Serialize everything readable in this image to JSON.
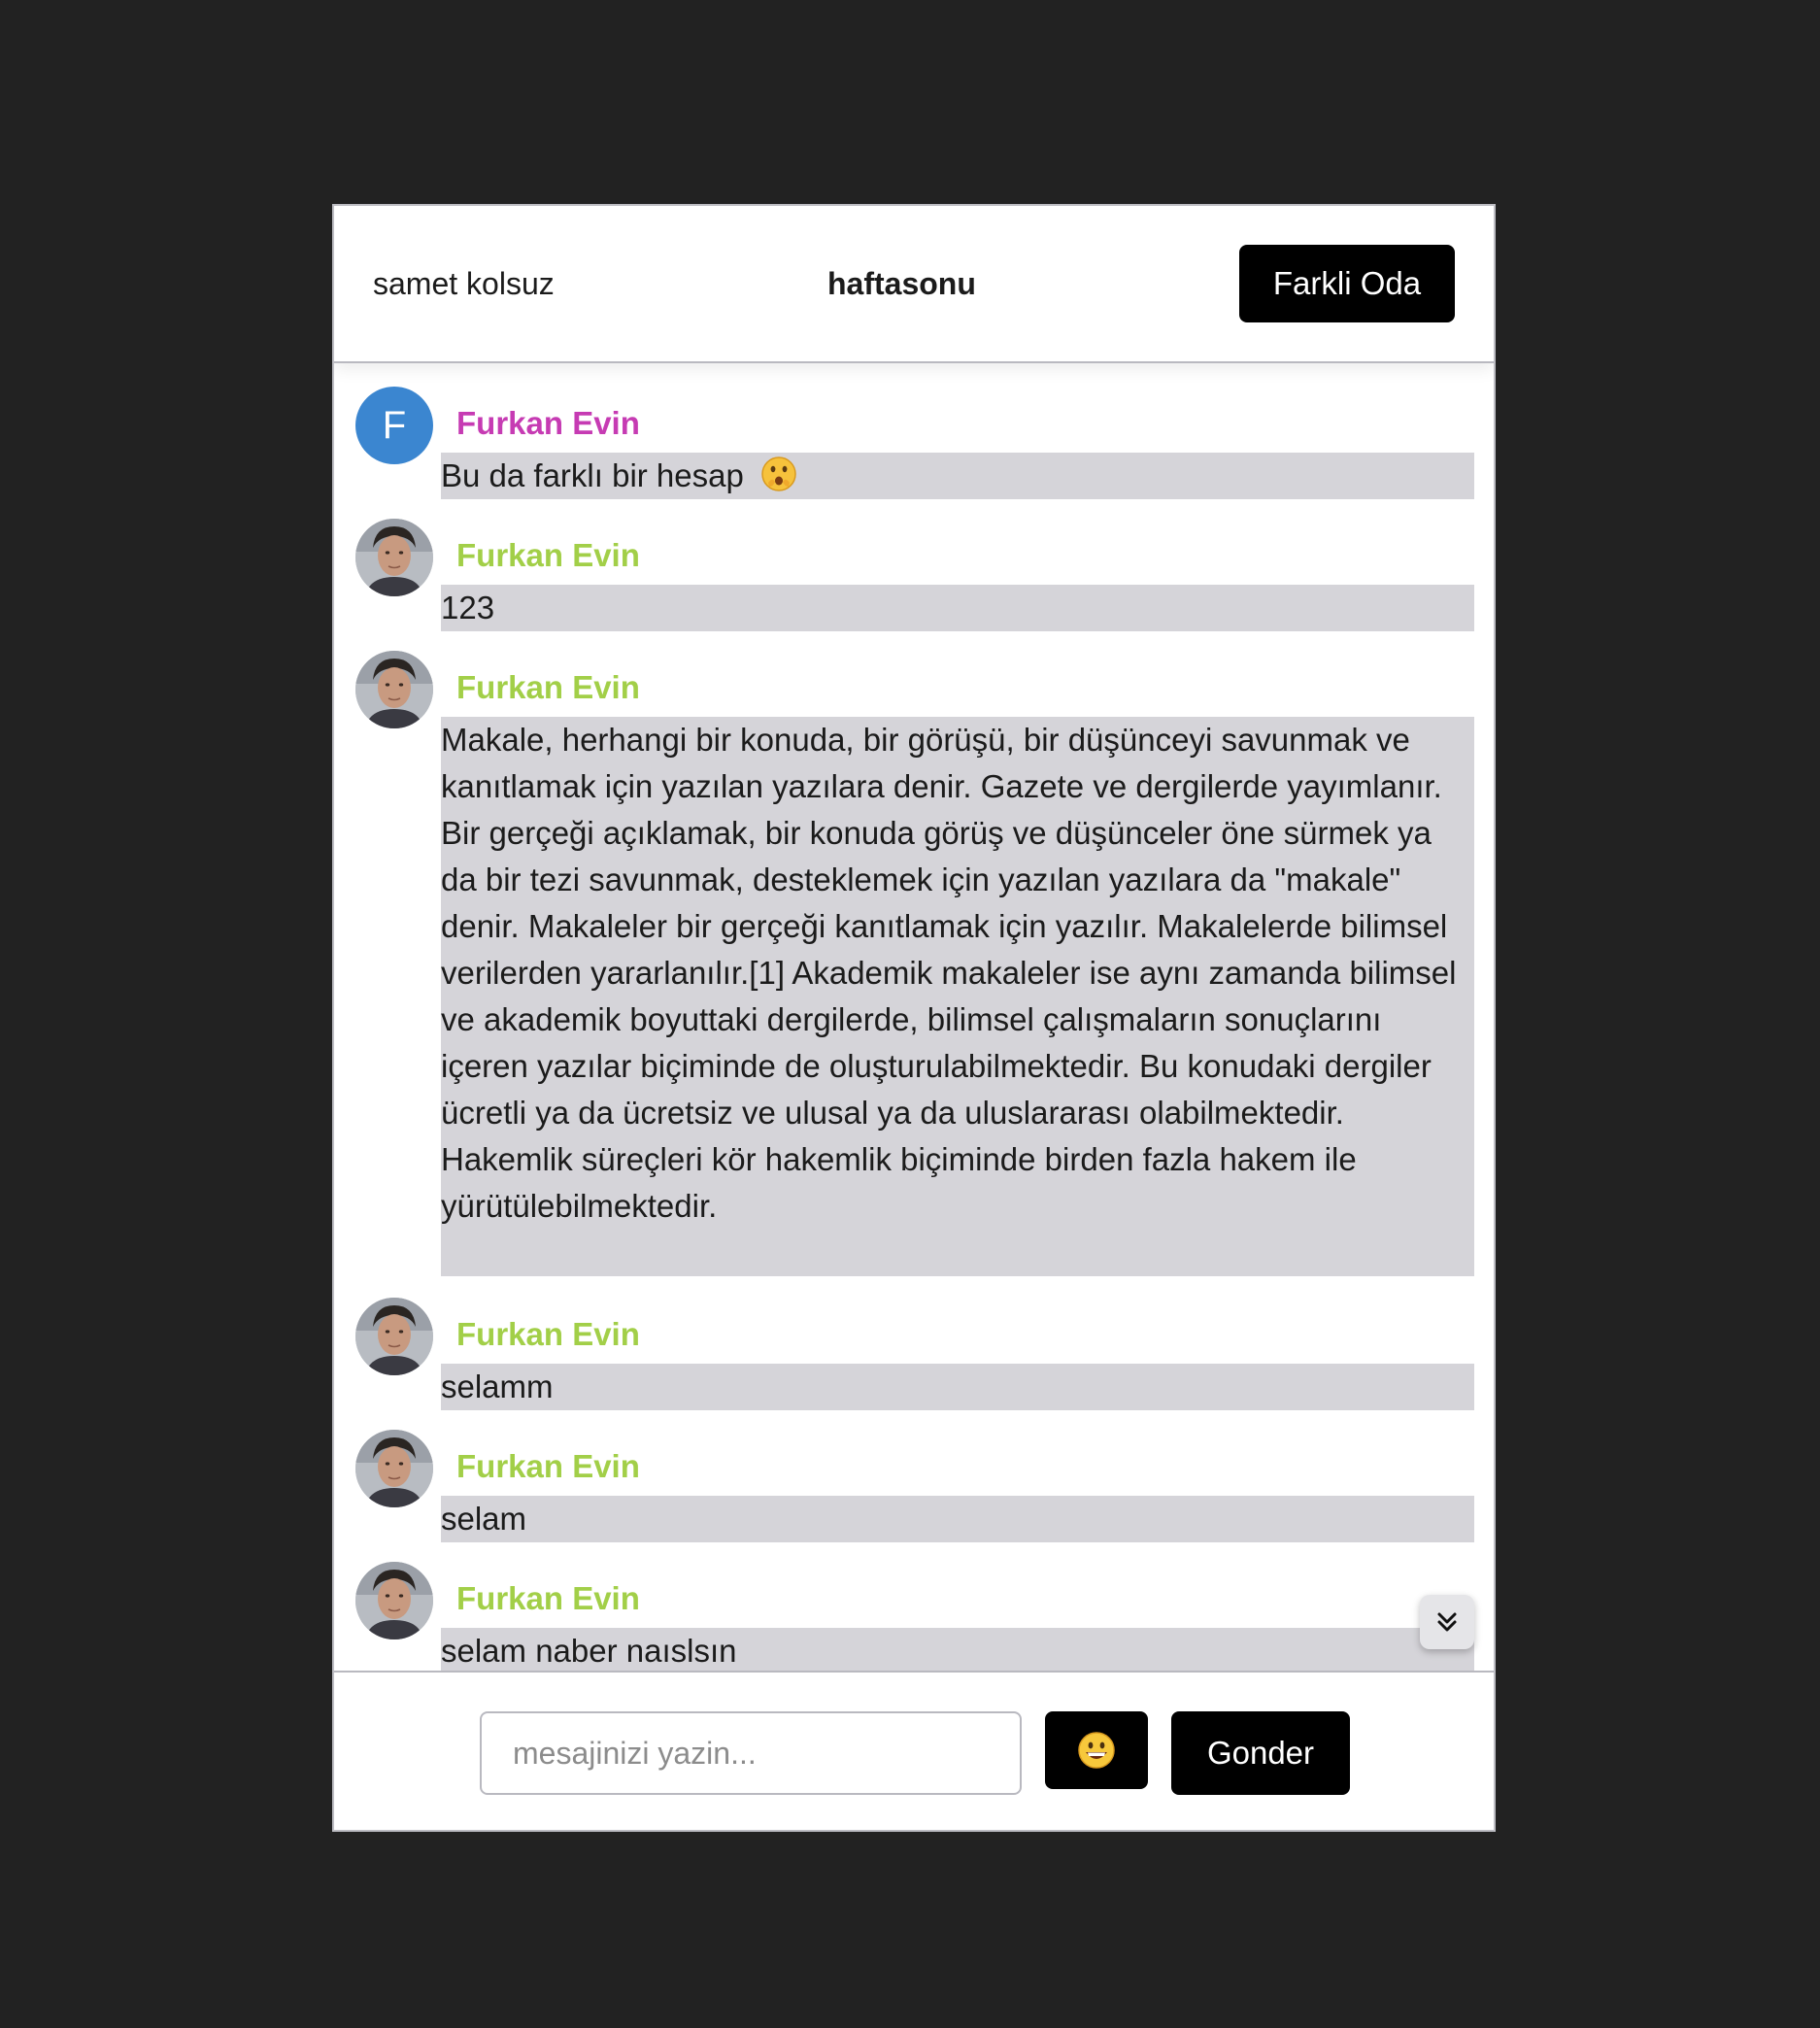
{
  "header": {
    "username": "samet kolsuz",
    "room": "haftasonu",
    "change_room_label": "Farkli Oda"
  },
  "messages": [
    {
      "author": "Furkan Evin",
      "author_color": "#c63bb3",
      "avatar_type": "letter",
      "avatar_letter": "F",
      "text": "Bu da farklı bir hesap",
      "emoji_icon": "shushing-face-icon"
    },
    {
      "author": "Furkan Evin",
      "author_color": "#a2cf48",
      "avatar_type": "photo",
      "text": "123"
    },
    {
      "author": "Furkan Evin",
      "author_color": "#a2cf48",
      "avatar_type": "photo",
      "text": "Makale, herhangi bir konuda, bir görüşü, bir düşünceyi savunmak ve kanıtlamak için yazılan yazılara denir. Gazete ve dergilerde yayımlanır. Bir gerçeği açıklamak, bir konuda görüş ve düşünceler öne sürmek ya da bir tezi savunmak, desteklemek için yazılan yazılara da \"makale\" denir. Makaleler bir gerçeği kanıtlamak için yazılır. Makalelerde bilimsel verilerden yararlanılır.[1] Akademik makaleler ise aynı zamanda bilimsel ve akademik boyuttaki dergilerde, bilimsel çalışmaların sonuçlarını içeren yazılar biçiminde de oluşturulabilmektedir. Bu konudaki dergiler ücretli ya da ücretsiz ve ulusal ya da uluslararası olabilmektedir. Hakemlik süreçleri kör hakemlik biçiminde birden fazla hakem ile yürütülebilmektedir."
    },
    {
      "author": "Furkan Evin",
      "author_color": "#a2cf48",
      "avatar_type": "photo",
      "text": "selamm"
    },
    {
      "author": "Furkan Evin",
      "author_color": "#a2cf48",
      "avatar_type": "photo",
      "text": "selam"
    },
    {
      "author": "Furkan Evin",
      "author_color": "#a2cf48",
      "avatar_type": "photo",
      "text": "selam naber naıslsın"
    }
  ],
  "composer": {
    "placeholder": "mesajinizi yazin...",
    "value": "",
    "emoji_button_icon": "grinning-face-icon",
    "send_label": "Gonder"
  },
  "scroll_button_icon": "double-chevron-down-icon",
  "colors": {
    "background": "#222222",
    "bubble": "#d5d4d9",
    "button": "#000000",
    "avatar_letter_bg": "#3b86d0"
  }
}
